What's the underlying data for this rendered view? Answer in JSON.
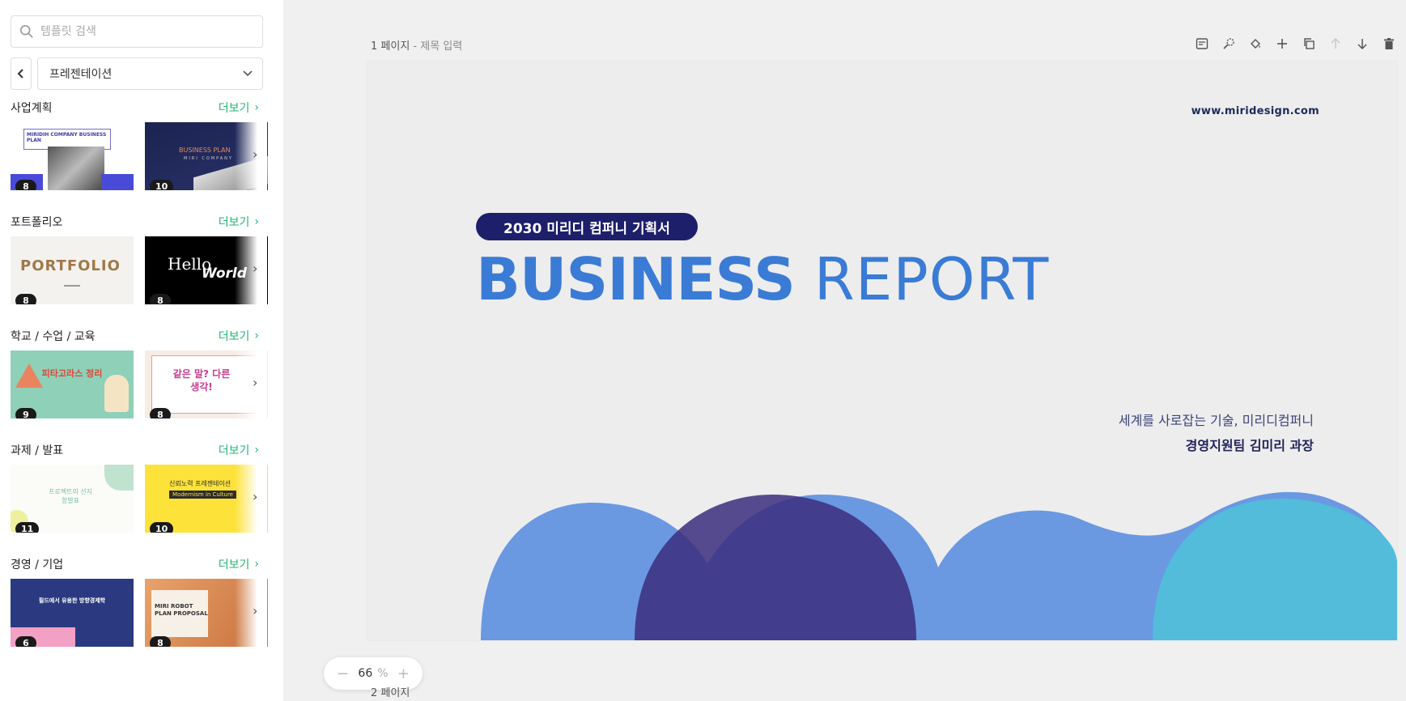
{
  "sidebar": {
    "search_placeholder": "템플릿 검색",
    "category": "프레젠테이션",
    "more_label": "더보기",
    "sections": [
      {
        "title": "사업계획",
        "counts": [
          "8",
          "10"
        ]
      },
      {
        "title": "포트폴리오",
        "counts": [
          "8",
          "8"
        ]
      },
      {
        "title": "학교 / 수업 / 교육",
        "counts": [
          "9",
          "8"
        ]
      },
      {
        "title": "과제 / 발표",
        "counts": [
          "11",
          "10"
        ]
      },
      {
        "title": "경영 / 기업",
        "counts": [
          "6",
          "8"
        ]
      }
    ],
    "thumb_texts": {
      "biz1": "MIRIDIH COMPANY BUSINESS PLAN",
      "biz2_a": "BUSINESS PLAN",
      "biz2_b": "MIRI COMPANY",
      "portfolio": "PORTFOLIO",
      "hello_a": "Hello",
      "hello_b": "World",
      "edu1": "피타고라스 정리",
      "edu2": "같은 말? 다른 생각!",
      "task1": "프로젝트의 선지함발표",
      "task2_a": "신뢰노력 프레젠테이션",
      "task2_b": "Modernism in Culture",
      "mgmt1": "필드에서 유용한 방향경제학",
      "mgmt2": "MIRI ROBOT PLAN PROPOSAL"
    }
  },
  "main": {
    "page1_label": "1 페이지",
    "page1_sub": " - 제목 입력",
    "page2_label": "2 페이지",
    "zoom_value": "66",
    "zoom_unit": "%"
  },
  "slide": {
    "url": "www.miridesign.com",
    "pill": "2030 미리디 컴퍼니 기획서",
    "headline_bold": "BUSINESS",
    "headline_light": " REPORT",
    "tagline": "세계를 사로잡는 기술, 미리디컴퍼니",
    "author": "경영지원팀 김미리 과장"
  },
  "colors": {
    "accent_green": "#22b573",
    "slide_blue": "#3a7bd5",
    "navy": "#1e1f6b",
    "wave_blue": "#4f86dd",
    "wave_purple": "#3b2f80",
    "wave_teal": "#4fc0d8"
  }
}
